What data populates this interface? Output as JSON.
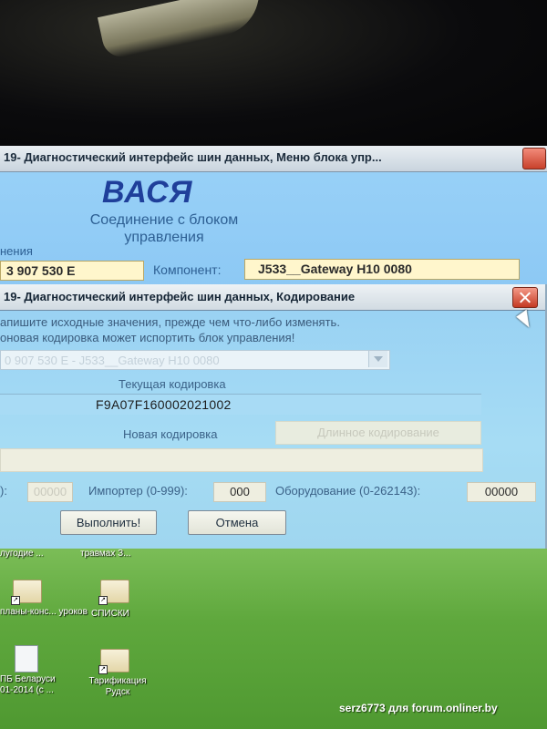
{
  "main_window": {
    "title": "19- Диагностический интерфейс шин данных,  Меню блока упр...",
    "logo": "ВАСЯ",
    "connection_line1": "Соединение с блоком",
    "connection_line2": "управления",
    "side_label": "нения",
    "part_number": "3 907 530 E",
    "component_label": "Компонент:",
    "component_value": "J533__Gateway    H10 0080"
  },
  "coding_dialog": {
    "title": "19- Диагностический интерфейс шин данных,  Кодирование",
    "warning_line1": "апишите исходные значения, прежде чем что-либо изменять.",
    "warning_line2": "оновая кодировка может испортить блок управления!",
    "module_select": "0 907 530 E - J533__Gateway   H10 0080",
    "current_coding_label": "Текущая кодировка",
    "current_coding_value": "F9A07F160002021002",
    "new_coding_label": "Новая кодировка",
    "long_coding_button": "Длинное кодирование",
    "left_field_label": "):",
    "left_field_value": "00000",
    "importer_label": "Импортер (0-999):",
    "importer_value": "000",
    "equipment_label": "Оборудование (0-262143):",
    "equipment_value": "00000",
    "execute_button": "Выполнить!",
    "cancel_button": "Отмена"
  },
  "desktop": {
    "icons": [
      {
        "label": "лугодие ..."
      },
      {
        "label": "травмах З..."
      },
      {
        "label": "планы-конс... уроков"
      },
      {
        "label": "СПИСКИ"
      },
      {
        "label": "ПБ Беларуси"
      },
      {
        "label": "01-2014 (с ..."
      },
      {
        "label": "Тарификация Рудск"
      }
    ]
  },
  "watermark": "serz6773 для forum.onliner.by"
}
